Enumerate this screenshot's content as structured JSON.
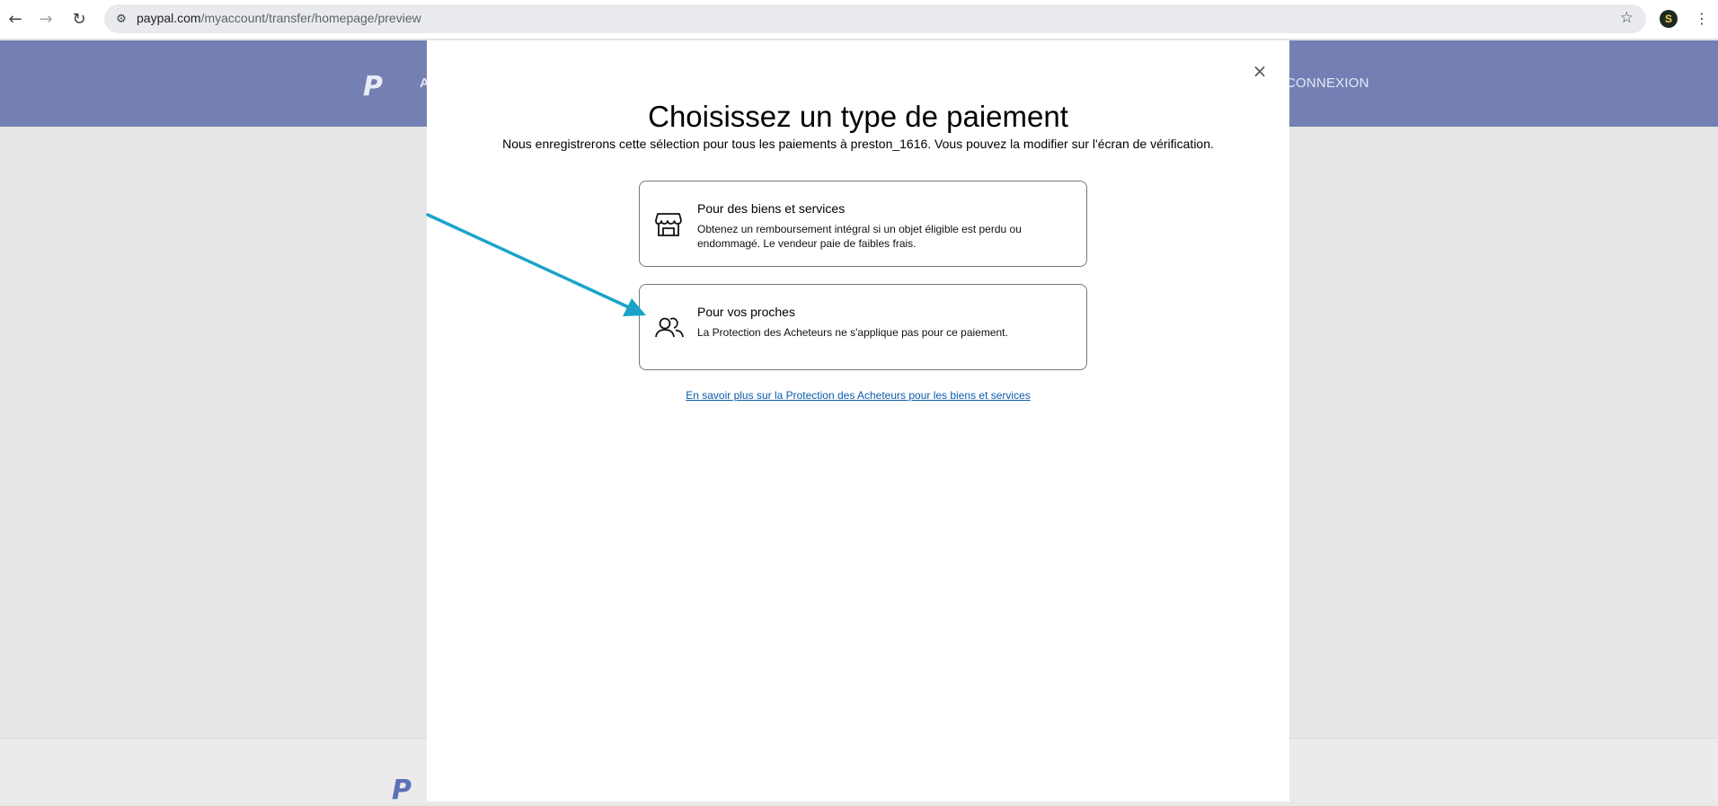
{
  "browser": {
    "back_glyph": "←",
    "forward_glyph": "→",
    "reload_glyph": "↻",
    "site_info_glyph": "⚙",
    "url_host": "paypal.com",
    "url_path": "/myaccount/transfer/homepage/preview",
    "bookmark_glyph": "☆",
    "profile_initial": "S",
    "menu_glyph": "⋮"
  },
  "site": {
    "logo_text": "P",
    "nav_fragment": "A",
    "login_label": "CONNEXION",
    "footer_logo_text": "P"
  },
  "modal": {
    "close_glyph": "×",
    "title": "Choisissez un type de paiement",
    "subtitle": "Nous enregistrerons cette sélection pour tous les paiements à preston_1616. Vous pouvez la modifier sur l'écran de vérification.",
    "options": [
      {
        "icon": "storefront-icon",
        "title": "Pour des biens et services",
        "description": "Obtenez un remboursement intégral si un objet éligible est perdu ou endommagé. Le vendeur paie de faibles frais."
      },
      {
        "icon": "people-icon",
        "title": "Pour vos proches",
        "description": "La Protection des Acheteurs ne s'applique pas pour ce paiement."
      }
    ],
    "learn_more_link": "En savoir plus sur la Protection des Acheteurs pour les biens et services"
  },
  "annotation": {
    "arrow_color": "#1aa3c9",
    "arrow_target": "Pour vos proches"
  },
  "colors": {
    "header_bg": "#7480b4",
    "overlay_bg": "#e6e6e6",
    "link": "#0b5cad"
  }
}
